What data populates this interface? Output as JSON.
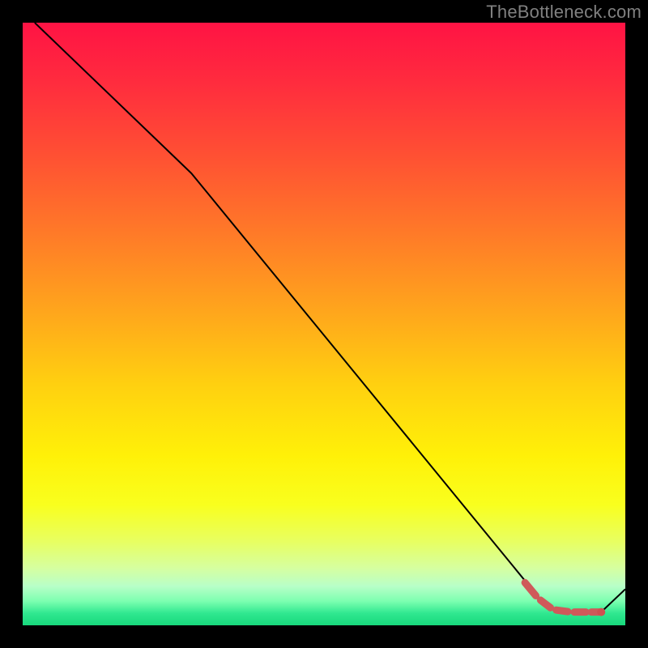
{
  "watermark": "TheBottleneck.com",
  "gradient_stops": [
    {
      "offset": 0.0,
      "color": "#ff1344"
    },
    {
      "offset": 0.1,
      "color": "#ff2c3e"
    },
    {
      "offset": 0.22,
      "color": "#ff5033"
    },
    {
      "offset": 0.35,
      "color": "#ff7a28"
    },
    {
      "offset": 0.48,
      "color": "#ffa61c"
    },
    {
      "offset": 0.6,
      "color": "#ffd010"
    },
    {
      "offset": 0.72,
      "color": "#fff108"
    },
    {
      "offset": 0.8,
      "color": "#f9ff1e"
    },
    {
      "offset": 0.86,
      "color": "#e8ff60"
    },
    {
      "offset": 0.905,
      "color": "#d6ffa0"
    },
    {
      "offset": 0.935,
      "color": "#b8ffc8"
    },
    {
      "offset": 0.96,
      "color": "#7cffb0"
    },
    {
      "offset": 0.98,
      "color": "#30e890"
    },
    {
      "offset": 1.0,
      "color": "#18d87c"
    }
  ],
  "chart_data": {
    "type": "line",
    "title": "",
    "xlabel": "",
    "ylabel": "",
    "xlim": [
      0,
      100
    ],
    "ylim": [
      0,
      100
    ],
    "grid": false,
    "legend": false,
    "series": [
      {
        "name": "bottleneck-curve",
        "style": "solid-thin-black",
        "points": [
          {
            "x": 2.0,
            "y": 100.0
          },
          {
            "x": 28.0,
            "y": 75.0
          },
          {
            "x": 84.5,
            "y": 6.0
          },
          {
            "x": 87.0,
            "y": 3.0
          },
          {
            "x": 92.0,
            "y": 2.0
          },
          {
            "x": 96.0,
            "y": 2.2
          },
          {
            "x": 100.0,
            "y": 6.0
          }
        ]
      },
      {
        "name": "optimal-range-marker",
        "style": "red-dashed-thick",
        "points": [
          {
            "x": 83.0,
            "y": 7.5
          },
          {
            "x": 85.5,
            "y": 4.5
          },
          {
            "x": 88.0,
            "y": 2.6
          },
          {
            "x": 91.0,
            "y": 2.2
          },
          {
            "x": 94.0,
            "y": 2.2
          },
          {
            "x": 96.0,
            "y": 2.2
          }
        ]
      }
    ],
    "markers": [
      {
        "name": "optimal-point",
        "x": 96.0,
        "y": 2.2,
        "color": "#d05050",
        "size": 5
      }
    ]
  }
}
